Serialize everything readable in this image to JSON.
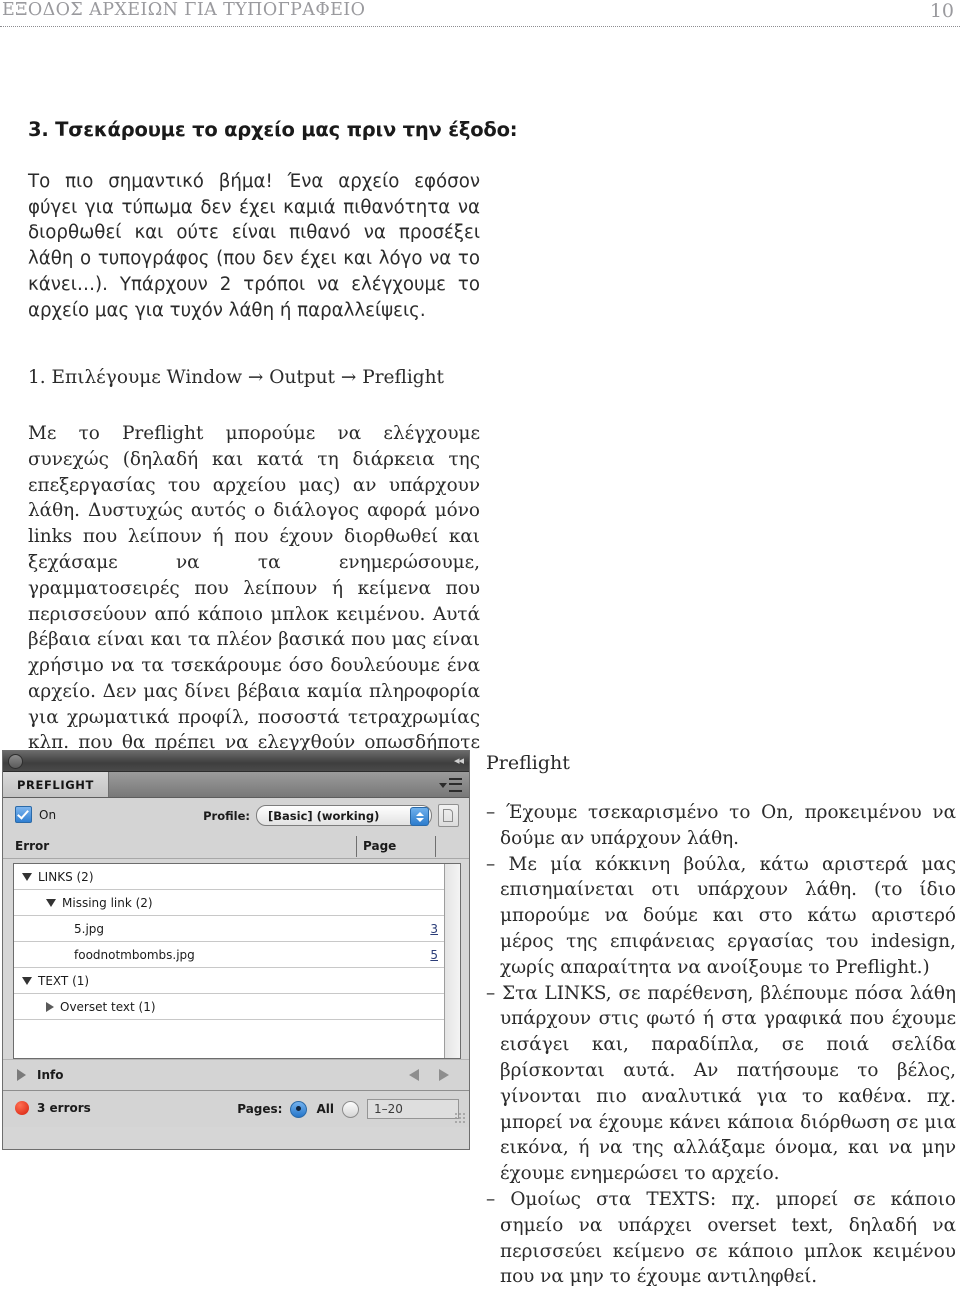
{
  "running_head": {
    "title": "ΕΞΟΔΟΣ ΑΡΧΕΙΩΝ ΓΙΑ ΤΥΠΟΓΡΑΦΕΙΟ",
    "page_number": "10"
  },
  "left_column": {
    "heading": "3. Τσεκάρουμε το αρχείο μας πριν την έξοδο:",
    "intro_paragraph": "Το πιο σημαντικό βήμα! Ένα αρχείο εφόσον φύγει για τύπωμα δεν έχει καμιά πιθανότητα να διορθωθεί και ούτε είναι πιθανό να προσέξει λάθη ο τυπογράφος (που δεν έχει και λόγο να το κάνει…). Υπάρχουν 2 τρόποι να ελέγχουμε το αρχείο μας για τυχόν λάθη ή παραλλείψεις.",
    "step_one": "1. Επιλέγουμε Window → Output → Preflight",
    "preflight_paragraph": "Με το Preflight μπορούμε να ελέγχουμε συνεχώς (δηλαδή και κατά τη διάρκεια της επεξεργασίας του αρχείου μας) αν υπάρχουν λάθη. Δυστυχώς αυτός ο διάλογος αφορά μόνο links που λείπουν ή που έχουν διορθωθεί και ξεχάσαμε να τα ενημερώσουμε, γραμματοσειρές που λείπουν ή κείμενα που περισσεύουν από κάποιο μπλοκ κειμένου. Αυτά βέβαια είναι και τα πλέον βασικά που μας είναι χρήσιμο να τα τσεκάρουμε όσο δουλεύουμε ένα αρχείο. Δεν μας δίνει βέβαια καμία πληροφορία για χρωματικά προφίλ, ποσοστά τετραχρωμίας κλπ. που θα πρέπει να ελεγχθούν οπωσδήποτε προτού κλείσουμε το έντυπο για τυπογραφείο."
  },
  "right_column": {
    "caption": "Preflight",
    "notes": [
      "Έχουμε τσεκαρισμένο το On, προκειμένου να δούμε αν υπάρχουν λάθη.",
      "Με μία κόκκινη βούλα, κάτω αριστερά μας επισημαίνεται οτι υπάρχουν λάθη. (το ίδιο μπορούμε να δούμε και στο κάτω αριστερό μέρος της επιφάνειας εργασίας του indesign, χωρίς απαραίτητα να ανοίξουμε το Preflight.)",
      "Στα LINKS, σε παρέθενση, βλέπουμε πόσα λάθη υπάρχουν στις φωτό ή στα γραφικά που έχουμε εισάγει και, παραδίπλα, σε ποιά σελίδα βρίσκονται αυτά. Αν πατήσουμε το βέλος, γίνονται πιο αναλυτικά για το καθένα. πχ. μπορεί να έχουμε κάνει κάποια διόρθωση σε μια εικόνα, ή να της αλλάξαμε όνομα, και να μην έχουμε ενημερώσει το αρχείο.",
      "Ομοίως στα TEXTS: πχ. μπορεί σε κάποιο σημείο να υπάρχει overset text, δηλαδή να περισσεύει κείμενο σε κάποιο μπλοκ κειμένου που να μην το έχουμε αντιληφθεί."
    ]
  },
  "preflight_panel": {
    "tab_label": "PREFLIGHT",
    "on_label": "On",
    "on_checked": true,
    "profile_label": "Profile:",
    "profile_value": "[Basic] (working)",
    "columns": {
      "error": "Error",
      "page": "Page"
    },
    "tree": [
      {
        "label": "LINKS (2)",
        "level": 0,
        "state": "open",
        "page": ""
      },
      {
        "label": "Missing link (2)",
        "level": 1,
        "state": "open",
        "page": ""
      },
      {
        "label": "5.jpg",
        "level": 2,
        "state": "none",
        "page": "3"
      },
      {
        "label": "foodnotmbombs.jpg",
        "level": 2,
        "state": "none",
        "page": "5"
      },
      {
        "label": "TEXT (1)",
        "level": 0,
        "state": "open",
        "page": ""
      },
      {
        "label": "Overset text (1)",
        "level": 1,
        "state": "closed",
        "page": ""
      }
    ],
    "info_label": "Info",
    "error_count": "3 errors",
    "pages_label": "Pages:",
    "radio_all_label": "All",
    "page_range_value": "1–20",
    "error_dot_color": "#d61f0c",
    "accent_color": "#2d7ccd"
  }
}
